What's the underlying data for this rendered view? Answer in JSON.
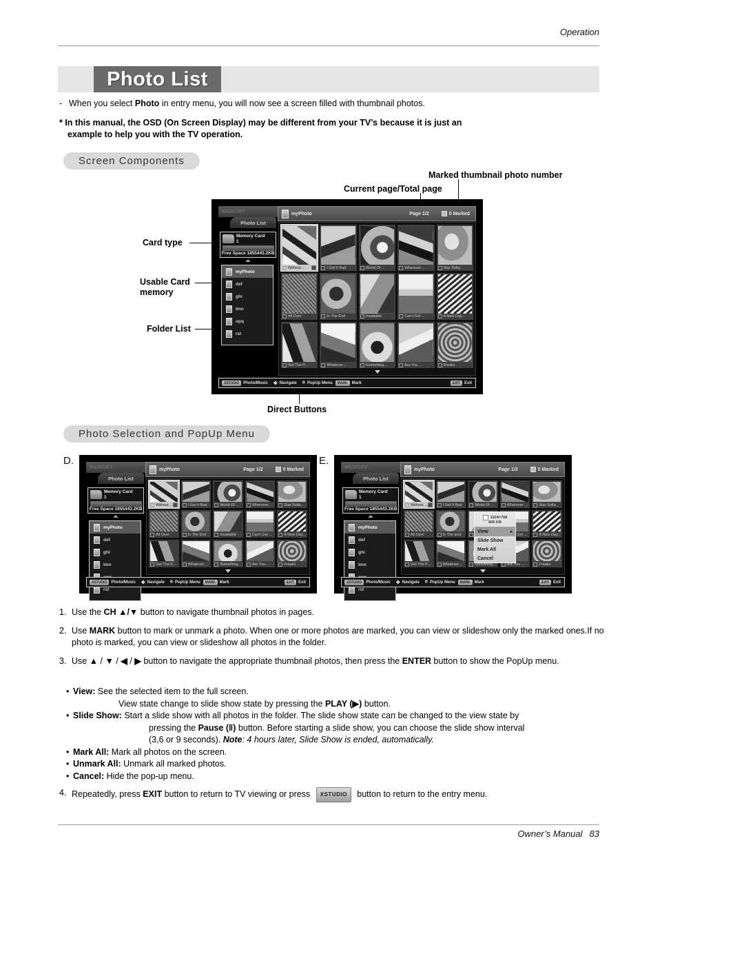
{
  "header": {
    "kicker": "Operation"
  },
  "title": {
    "text": "Photo List"
  },
  "intro": {
    "dash": "-",
    "line_a": "When you select ",
    "bold_photo": "Photo",
    "line_b": " in entry menu, you will now see a screen filled with thumbnail photos."
  },
  "note": {
    "line1": "* In this manual, the OSD (On Screen Display) may be different from your TV’s because it is just an",
    "line2": "example to help you with the TV operation."
  },
  "sections": {
    "screen_components": "Screen Components",
    "photo_selection": "Photo Selection and PopUp Menu"
  },
  "annotations": {
    "marked_thumbnail": "Marked thumbnail photo number",
    "current_total_page": "Current page/Total page",
    "card_type": "Card type",
    "usable_card_memory_l1": "Usable Card",
    "usable_card_memory_l2": "memory",
    "folder_list": "Folder List",
    "direct_buttons": "Direct Buttons"
  },
  "osd": {
    "memory_tab": "MEMORY",
    "photo_list_tab": "Photo List",
    "topbar": {
      "title": "myPhoto",
      "page": "Page  1/2",
      "marked": "0 Marked"
    },
    "card": {
      "name_l1": "Memory Card",
      "name_l2": "1",
      "free_space": "Free Space 1855443.2KB"
    },
    "folders": [
      {
        "label": "myPhoto",
        "selected": true
      },
      {
        "label": "def",
        "selected": false
      },
      {
        "label": "ghi",
        "selected": false
      },
      {
        "label": "lmn",
        "selected": false
      },
      {
        "label": "opq",
        "selected": false
      },
      {
        "label": "rst",
        "selected": false
      }
    ],
    "thumbnails": [
      {
        "label": "Without ...",
        "selected": true
      },
      {
        "label": "I Get It Bad",
        "selected": false
      },
      {
        "label": "World Of ...",
        "selected": false
      },
      {
        "label": "Wherever ...",
        "selected": false
      },
      {
        "label": "Star Sofia...",
        "selected": false
      },
      {
        "label": "All Over",
        "selected": false
      },
      {
        "label": "In The End",
        "selected": false
      },
      {
        "label": "Insatiable",
        "selected": false
      },
      {
        "label": "Can’t Get ...",
        "selected": false
      },
      {
        "label": "A New Day...",
        "selected": false
      },
      {
        "label": "Get The P...",
        "selected": false
      },
      {
        "label": "Whatever...",
        "selected": false
      },
      {
        "label": "Something...",
        "selected": false
      },
      {
        "label": "Are You ...",
        "selected": false
      },
      {
        "label": "Freaks",
        "selected": false
      }
    ],
    "bottombar": {
      "key1": "XSTUDIO",
      "item1": "Photo/Music",
      "item2": "Navigate",
      "item3": "PopUp Menu",
      "key4": "MARK",
      "item4": "Mark",
      "key5": "EXIT",
      "item5": "Exit"
    },
    "bottombar_e": {
      "key4": "MARK",
      "item4": "Mark"
    }
  },
  "panel_letters": {
    "d": "D.",
    "e": "E."
  },
  "popup": {
    "resolution": "1024×768",
    "filesize": "800 KB",
    "items": [
      {
        "label": "View",
        "selected": true,
        "arrow": "▸"
      },
      {
        "label": "Slide Show",
        "selected": false,
        "arrow": ""
      },
      {
        "label": "Mark All",
        "selected": false,
        "arrow": ""
      },
      {
        "label": "Cancel",
        "selected": false,
        "arrow": ""
      }
    ]
  },
  "steps": [
    {
      "num": "1.",
      "parts": [
        {
          "t": "Use the "
        },
        {
          "t": "CH ▲/▼",
          "b": true
        },
        {
          "t": " button to navigate thumbnail photos in pages."
        }
      ]
    },
    {
      "num": "2.",
      "parts": [
        {
          "t": "Use "
        },
        {
          "t": "MARK",
          "b": true
        },
        {
          "t": " button to mark or unmark a photo. When one or more photos are marked, you can view or slideshow only the marked ones.If no photo is marked, you can view or slideshow all photos in the folder."
        }
      ]
    },
    {
      "num": "3.",
      "parts": [
        {
          "t": "Use "
        },
        {
          "t": "▲",
          "b": true
        },
        {
          "t": " / "
        },
        {
          "t": "▼",
          "b": true
        },
        {
          "t": " / "
        },
        {
          "t": "◀",
          "b": true
        },
        {
          "t": " / "
        },
        {
          "t": "▶",
          "b": true
        },
        {
          "t": " button to navigate the appropriate thumbnail photos, then press the "
        },
        {
          "t": "ENTER",
          "b": true
        },
        {
          "t": " button to show the PopUp menu."
        }
      ]
    }
  ],
  "bullets": {
    "view_term": "View:",
    "view_text": " See the selected item to the full screen.",
    "view_cont_a": "View state change to slide show state by pressing the ",
    "view_cont_b": "PLAY (▶)",
    "view_cont_c": " button.",
    "slideshow_term": "Slide Show:",
    "slideshow_text": " Start a slide show with all photos in the folder. The slide show state can be changed to the view state by",
    "slideshow_cont_a": "pressing the ",
    "slideshow_cont_b": "Pause (‖)",
    "slideshow_cont_c": " button. Before starting a slide show, you can choose the slide show interval",
    "slideshow_cont_d": "(3,6 or 9 seconds). ",
    "slideshow_cont_e": "Note",
    "slideshow_cont_f": ": 4 hours later, Slide Show is ended, automatically.",
    "markall_term": "Mark All:",
    "markall_text": " Mark all photos on the screen.",
    "unmarkall_term": "Unmark All:",
    "unmarkall_text": " Unmark all marked photos.",
    "cancel_term": "Cancel:",
    "cancel_text": " Hide the pop-up menu."
  },
  "step4": {
    "num": "4.",
    "a": "Repeatedly, press ",
    "exit": "EXIT",
    "b": " button to return to TV viewing or press ",
    "key": "XSTUDIO",
    "c": " button to return to the entry menu."
  },
  "footer": {
    "manual": "Owner’s Manual",
    "page": "83"
  },
  "colors": {
    "title_box": "#6b6b6b",
    "band": "#e6e6e6",
    "pill": "#d9d9d9",
    "rule": "#9a9a9a"
  }
}
